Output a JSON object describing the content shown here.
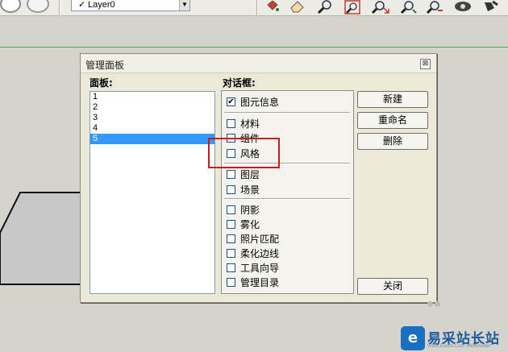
{
  "toolbar": {
    "layer_check": "✓",
    "layer_name": "Layer0",
    "dropdown_arrow": "▼",
    "icons": [
      "paint-bucket-icon",
      "eraser-icon",
      "zoom-icon",
      "zoom-window-icon",
      "zoom-extents-icon",
      "previous-view-icon",
      "camera-icon",
      "walk-icon"
    ]
  },
  "dialog": {
    "title": "管理面板",
    "close_glyph": "⊠",
    "panel_label": "面板:",
    "panels": [
      "1",
      "2",
      "3",
      "4",
      "5"
    ],
    "selected_panel": "5",
    "dialogs_label": "对话框:",
    "checkboxes": [
      {
        "label": "图元信息",
        "checked": true
      },
      {
        "label": "材料",
        "checked": false
      },
      {
        "label": "组件",
        "checked": false
      },
      {
        "label": "风格",
        "checked": false
      },
      {
        "label": "图层",
        "checked": false
      },
      {
        "label": "场景",
        "checked": false
      },
      {
        "label": "阴影",
        "checked": false
      },
      {
        "label": "雾化",
        "checked": false
      },
      {
        "label": "照片匹配",
        "checked": false
      },
      {
        "label": "柔化边线",
        "checked": false
      },
      {
        "label": "工具向导",
        "checked": false
      },
      {
        "label": "管理目录",
        "checked": false
      }
    ],
    "check_mark": "✔",
    "buttons": {
      "new": "新建",
      "rename": "重命名",
      "delete": "删除",
      "close": "关闭"
    }
  },
  "watermark": {
    "text": "易采站长站",
    "sub": "Www.Easck.Com Webmaster",
    "logo_glyph": "e"
  },
  "colors": {
    "highlight": "#c41e1e",
    "selection": "#3399ff",
    "axis": "#4c9f53"
  }
}
